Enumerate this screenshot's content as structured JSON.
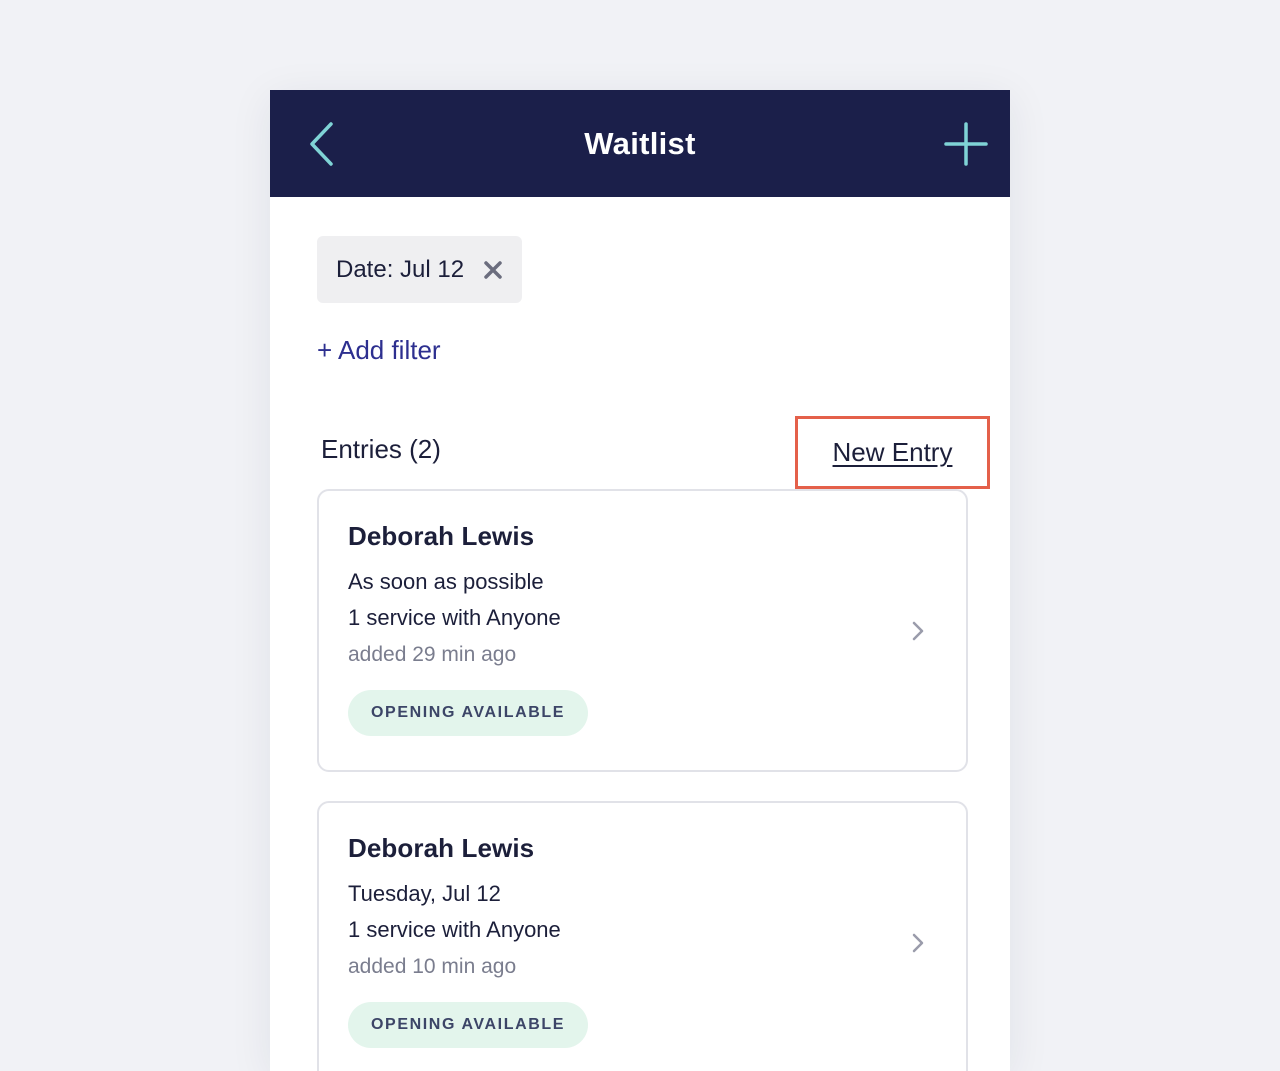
{
  "header": {
    "title": "Waitlist",
    "back_icon": "chevron-left-icon",
    "add_icon": "plus-icon"
  },
  "filters": {
    "chips": [
      {
        "label": "Date: Jul 12",
        "remove_icon": "close-icon"
      }
    ],
    "add_filter_label": "+ Add filter"
  },
  "entries": {
    "heading": "Entries (2)",
    "new_entry_label": "New Entry",
    "items": [
      {
        "name": "Deborah Lewis",
        "timing": "As soon as possible",
        "service": "1 service with Anyone",
        "added": "added 29 min ago",
        "status": "OPENING AVAILABLE"
      },
      {
        "name": "Deborah Lewis",
        "timing": "Tuesday, Jul 12",
        "service": "1 service with Anyone",
        "added": "added 10 min ago",
        "status": "OPENING AVAILABLE"
      }
    ]
  },
  "colors": {
    "header_bg": "#1b1f4a",
    "accent_icon": "#7fd3d6",
    "link": "#2d2f8f",
    "highlight_border": "#e4604a",
    "status_badge_bg": "#e3f5ec"
  }
}
